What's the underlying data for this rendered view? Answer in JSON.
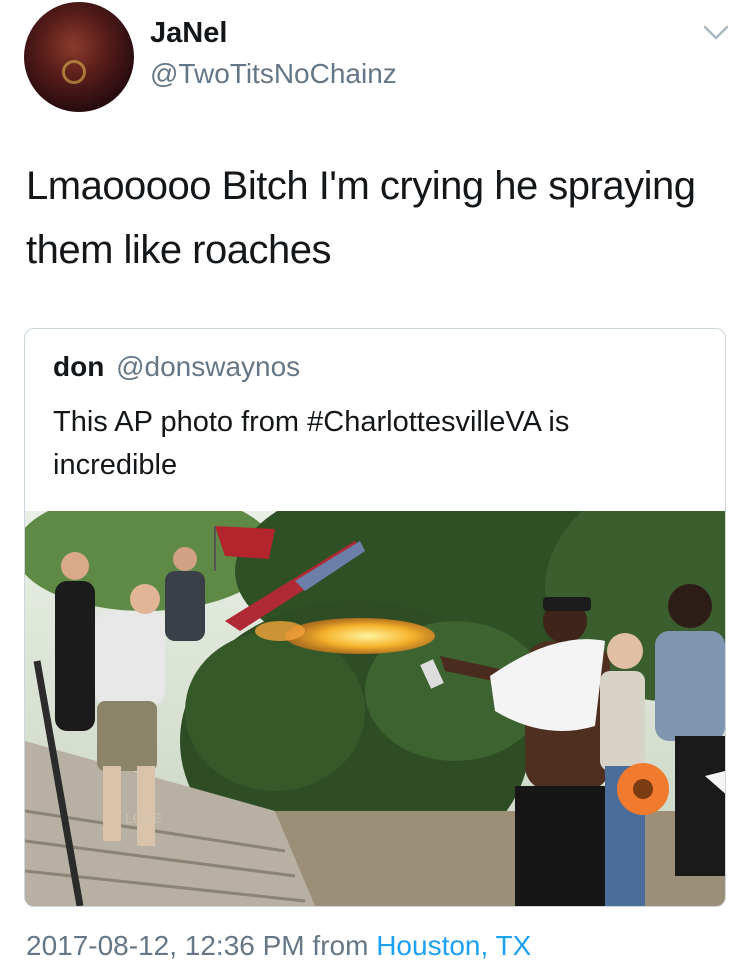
{
  "tweet": {
    "display_name": "JaNel",
    "handle": "@TwoTitsNoChainz",
    "text": "Lmaooooo Bitch I'm crying he spraying them like roaches",
    "avatar_icon": "profile-photo"
  },
  "quoted_tweet": {
    "display_name": "don",
    "handle": "@donswaynos",
    "text": "This AP photo from #CharlottesvilleVA is incredible",
    "photo": "news-photo-spray-flame"
  },
  "footer": {
    "timestamp": "2017-08-12, 12:36 PM",
    "from": "from",
    "location": "Houston, TX"
  },
  "colors": {
    "text": "#14171a",
    "secondary": "#657786",
    "link": "#1da1f2",
    "border": "#ccd6dd"
  }
}
